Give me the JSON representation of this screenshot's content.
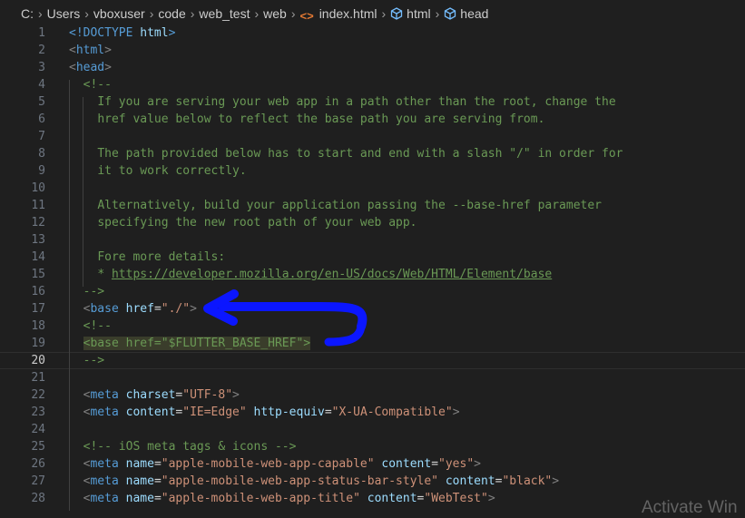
{
  "breadcrumb": {
    "segments": [
      "C:",
      "Users",
      "vboxuser",
      "code",
      "web_test",
      "web",
      "index.html",
      "html",
      "head"
    ]
  },
  "colors": {
    "background": "#1f1f1f",
    "tag": "#569cd6",
    "attribute": "#9cdcfe",
    "string": "#ce9178",
    "comment": "#6a9955",
    "annotation_arrow": "#0b16ff"
  },
  "editor": {
    "current_line": 20,
    "lines": [
      {
        "n": "1",
        "indent": "",
        "parts": [
          [
            "doc",
            "<!DOCTYPE"
          ],
          [
            "plain",
            " "
          ],
          [
            "attr",
            "html"
          ],
          [
            "doc",
            ">"
          ]
        ]
      },
      {
        "n": "2",
        "indent": "",
        "parts": [
          [
            "punct",
            "<"
          ],
          [
            "tag",
            "html"
          ],
          [
            "punct",
            ">"
          ]
        ]
      },
      {
        "n": "3",
        "indent": "",
        "parts": [
          [
            "punct",
            "<"
          ],
          [
            "tag",
            "head"
          ],
          [
            "punct",
            ">"
          ]
        ]
      },
      {
        "n": "4",
        "indent": "  ",
        "parts": [
          [
            "cmt",
            "<!--"
          ]
        ]
      },
      {
        "n": "5",
        "indent": "    ",
        "parts": [
          [
            "cmt",
            "If you are serving your web app in a path other than the root, change the"
          ]
        ]
      },
      {
        "n": "6",
        "indent": "    ",
        "parts": [
          [
            "cmt",
            "href value below to reflect the base path you are serving from."
          ]
        ]
      },
      {
        "n": "7",
        "indent": "",
        "parts": []
      },
      {
        "n": "8",
        "indent": "    ",
        "parts": [
          [
            "cmt",
            "The path provided below has to start and end with a slash \"/\" in order for"
          ]
        ]
      },
      {
        "n": "9",
        "indent": "    ",
        "parts": [
          [
            "cmt",
            "it to work correctly."
          ]
        ]
      },
      {
        "n": "10",
        "indent": "",
        "parts": []
      },
      {
        "n": "11",
        "indent": "    ",
        "parts": [
          [
            "cmt",
            "Alternatively, build your application passing the --base-href parameter"
          ]
        ]
      },
      {
        "n": "12",
        "indent": "    ",
        "parts": [
          [
            "cmt",
            "specifying the new root path of your web app."
          ]
        ]
      },
      {
        "n": "13",
        "indent": "",
        "parts": []
      },
      {
        "n": "14",
        "indent": "    ",
        "parts": [
          [
            "cmt",
            "Fore more details:"
          ]
        ]
      },
      {
        "n": "15",
        "indent": "    ",
        "parts": [
          [
            "cmt",
            "* "
          ],
          [
            "link",
            "https://developer.mozilla.org/en-US/docs/Web/HTML/Element/base"
          ]
        ]
      },
      {
        "n": "16",
        "indent": "  ",
        "parts": [
          [
            "cmt",
            "-->"
          ]
        ]
      },
      {
        "n": "17",
        "indent": "  ",
        "parts": [
          [
            "punct",
            "<"
          ],
          [
            "tag",
            "base"
          ],
          [
            "plain",
            " "
          ],
          [
            "attr",
            "href"
          ],
          [
            "eq",
            "="
          ],
          [
            "str",
            "\"./\""
          ],
          [
            "punct",
            ">"
          ]
        ]
      },
      {
        "n": "18",
        "indent": "  ",
        "parts": [
          [
            "cmt",
            "<!--"
          ]
        ]
      },
      {
        "n": "19",
        "indent": "  ",
        "highlight": true,
        "parts": [
          [
            "cmt",
            "<base href=\"$FLUTTER_BASE_HREF\">"
          ]
        ]
      },
      {
        "n": "20",
        "indent": "  ",
        "parts": [
          [
            "cmt",
            "-->"
          ]
        ]
      },
      {
        "n": "21",
        "indent": "",
        "parts": []
      },
      {
        "n": "22",
        "indent": "  ",
        "parts": [
          [
            "punct",
            "<"
          ],
          [
            "tag",
            "meta"
          ],
          [
            "plain",
            " "
          ],
          [
            "attr",
            "charset"
          ],
          [
            "eq",
            "="
          ],
          [
            "str",
            "\"UTF-8\""
          ],
          [
            "punct",
            ">"
          ]
        ]
      },
      {
        "n": "23",
        "indent": "  ",
        "parts": [
          [
            "punct",
            "<"
          ],
          [
            "tag",
            "meta"
          ],
          [
            "plain",
            " "
          ],
          [
            "attr",
            "content"
          ],
          [
            "eq",
            "="
          ],
          [
            "str",
            "\"IE=Edge\""
          ],
          [
            "plain",
            " "
          ],
          [
            "attr",
            "http-equiv"
          ],
          [
            "eq",
            "="
          ],
          [
            "str",
            "\"X-UA-Compatible\""
          ],
          [
            "punct",
            ">"
          ]
        ]
      },
      {
        "n": "24",
        "indent": "",
        "parts": []
      },
      {
        "n": "25",
        "indent": "  ",
        "parts": [
          [
            "cmt",
            "<!-- iOS meta tags & icons -->"
          ]
        ]
      },
      {
        "n": "26",
        "indent": "  ",
        "parts": [
          [
            "punct",
            "<"
          ],
          [
            "tag",
            "meta"
          ],
          [
            "plain",
            " "
          ],
          [
            "attr",
            "name"
          ],
          [
            "eq",
            "="
          ],
          [
            "str",
            "\"apple-mobile-web-app-capable\""
          ],
          [
            "plain",
            " "
          ],
          [
            "attr",
            "content"
          ],
          [
            "eq",
            "="
          ],
          [
            "str",
            "\"yes\""
          ],
          [
            "punct",
            ">"
          ]
        ]
      },
      {
        "n": "27",
        "indent": "  ",
        "parts": [
          [
            "punct",
            "<"
          ],
          [
            "tag",
            "meta"
          ],
          [
            "plain",
            " "
          ],
          [
            "attr",
            "name"
          ],
          [
            "eq",
            "="
          ],
          [
            "str",
            "\"apple-mobile-web-app-status-bar-style\""
          ],
          [
            "plain",
            " "
          ],
          [
            "attr",
            "content"
          ],
          [
            "eq",
            "="
          ],
          [
            "str",
            "\"black\""
          ],
          [
            "punct",
            ">"
          ]
        ]
      },
      {
        "n": "28",
        "indent": "  ",
        "parts": [
          [
            "punct",
            "<"
          ],
          [
            "tag",
            "meta"
          ],
          [
            "plain",
            " "
          ],
          [
            "attr",
            "name"
          ],
          [
            "eq",
            "="
          ],
          [
            "str",
            "\"apple-mobile-web-app-title\""
          ],
          [
            "plain",
            " "
          ],
          [
            "attr",
            "content"
          ],
          [
            "eq",
            "="
          ],
          [
            "str",
            "\"WebTest\""
          ],
          [
            "punct",
            ">"
          ]
        ]
      }
    ]
  },
  "watermark": "Activate Win"
}
